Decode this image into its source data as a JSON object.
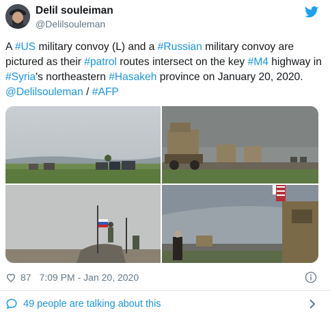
{
  "author": {
    "name": "Delil souleiman",
    "handle": "@Delilsouleman"
  },
  "tweet": {
    "segments": [
      {
        "text": "A ",
        "tag": false
      },
      {
        "text": "#US",
        "tag": true
      },
      {
        "text": " military convoy (L) and a ",
        "tag": false
      },
      {
        "text": "#Russian",
        "tag": true
      },
      {
        "text": " military convoy are pictured as their ",
        "tag": false
      },
      {
        "text": "#patrol",
        "tag": true
      },
      {
        "text": " routes intersect on the key ",
        "tag": false
      },
      {
        "text": "#M4",
        "tag": true
      },
      {
        "text": " highway in ",
        "tag": false
      },
      {
        "text": "#Syria",
        "tag": true
      },
      {
        "text": "'s northeastern ",
        "tag": false
      },
      {
        "text": "#Hasakeh",
        "tag": true
      },
      {
        "text": " province on January 20, 2020.  ",
        "tag": false
      },
      {
        "text": "@Delilsouleman",
        "tag": true
      },
      {
        "text": "  / ",
        "tag": false
      },
      {
        "text": "#AFP",
        "tag": true
      }
    ]
  },
  "meta": {
    "likes": "87",
    "timestamp": "7:09 PM - Jan 20, 2020"
  },
  "talking": {
    "label": "49 people are talking about this"
  },
  "colors": {
    "accent": "#1b95e0",
    "text": "#14171a",
    "muted": "#657786",
    "divider": "#e1e8ed"
  },
  "icons": [
    "twitter-icon",
    "heart-icon",
    "info-icon",
    "speech-bubble-icon",
    "chevron-right-icon"
  ]
}
